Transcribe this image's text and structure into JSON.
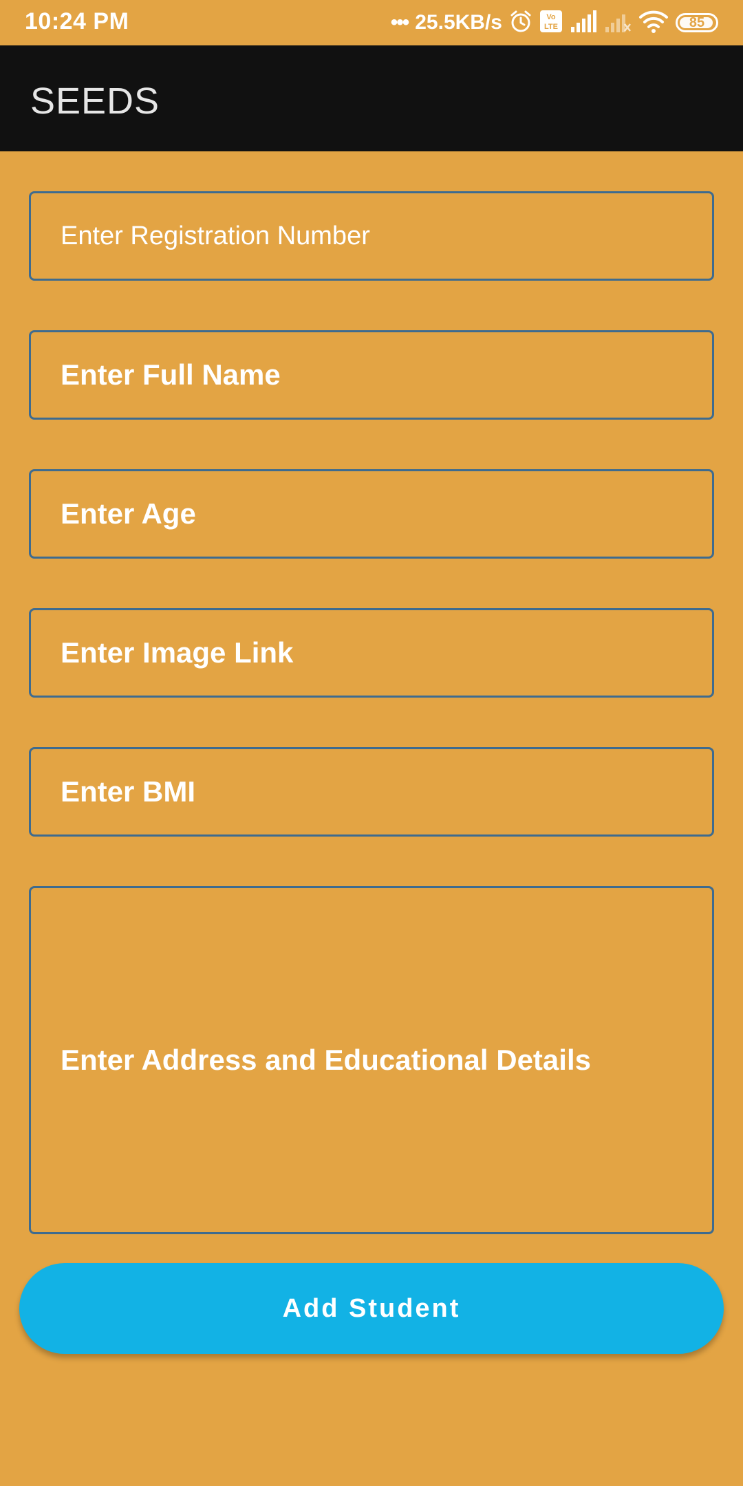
{
  "status_bar": {
    "time": "10:24 PM",
    "dots": "•••",
    "network_speed": "25.5KB/s",
    "battery_level": "85",
    "icons": [
      "alarm-icon",
      "volte-icon",
      "signal-icon",
      "signal-weak-icon",
      "wifi-icon",
      "battery-icon"
    ]
  },
  "app_bar": {
    "title": "SEEDS"
  },
  "form": {
    "registration_placeholder": "Enter Registration Number",
    "full_name_placeholder": "Enter Full Name",
    "age_placeholder": "Enter Age",
    "image_link_placeholder": "Enter Image Link",
    "bmi_placeholder": "Enter BMI",
    "address_placeholder": "Enter Address and Educational Details",
    "submit_label": "Add Student"
  },
  "colors": {
    "background": "#E3A444",
    "app_bar": "#111111",
    "field_border": "#3E6B8F",
    "button": "#12B2E5",
    "text": "#FFFFFF"
  }
}
